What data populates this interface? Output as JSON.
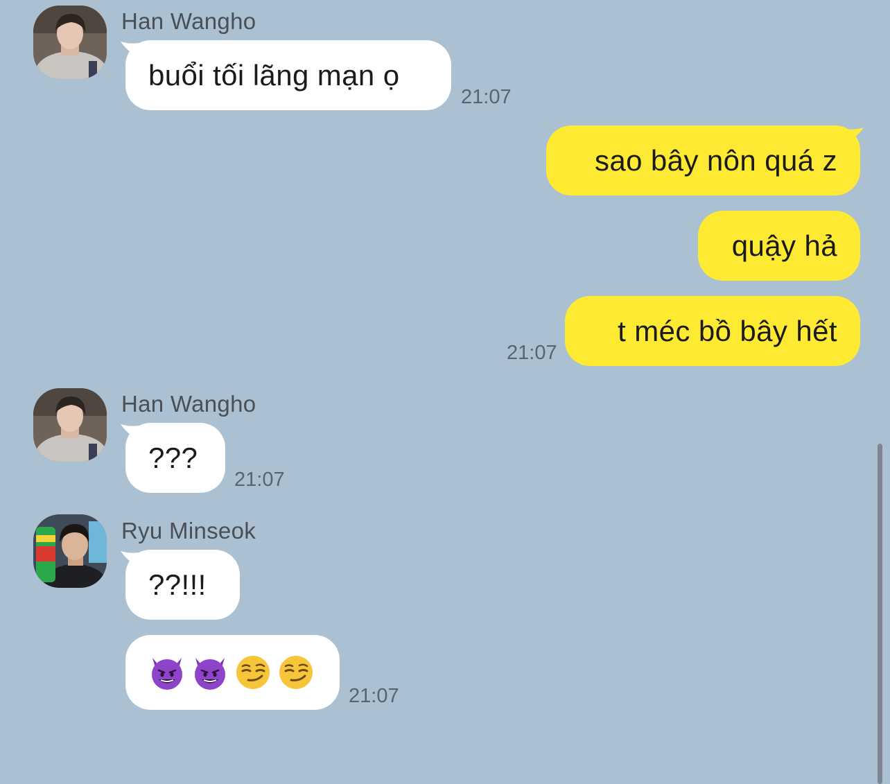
{
  "conversation": {
    "group1": {
      "sender": "Han Wangho",
      "avatar_icon": "avatar-han-wangho",
      "messages": [
        {
          "text": "buổi tối lãng mạn ọ"
        }
      ],
      "time": "21:07"
    },
    "group2": {
      "sender": "me",
      "messages": [
        {
          "text": "sao bây nôn quá z"
        },
        {
          "text": "quậy hả"
        },
        {
          "text": "t méc bồ bây hết"
        }
      ],
      "time": "21:07"
    },
    "group3": {
      "sender": "Han Wangho",
      "avatar_icon": "avatar-han-wangho",
      "messages": [
        {
          "text": "???"
        }
      ],
      "time": "21:07"
    },
    "group4": {
      "sender": "Ryu Minseok",
      "avatar_icon": "avatar-ryu-minseok",
      "messages": [
        {
          "text": "??!!!"
        },
        {
          "emojis": [
            "smiling-devil",
            "smiling-devil",
            "smirking-face",
            "smirking-face"
          ]
        }
      ],
      "time": "21:07"
    }
  },
  "colors": {
    "background": "#abc1d1",
    "incoming_bubble": "#ffffff",
    "outgoing_bubble": "#ffea33",
    "devil_purple": "#8e44c9",
    "smirk_yellow": "#f7c53a"
  }
}
